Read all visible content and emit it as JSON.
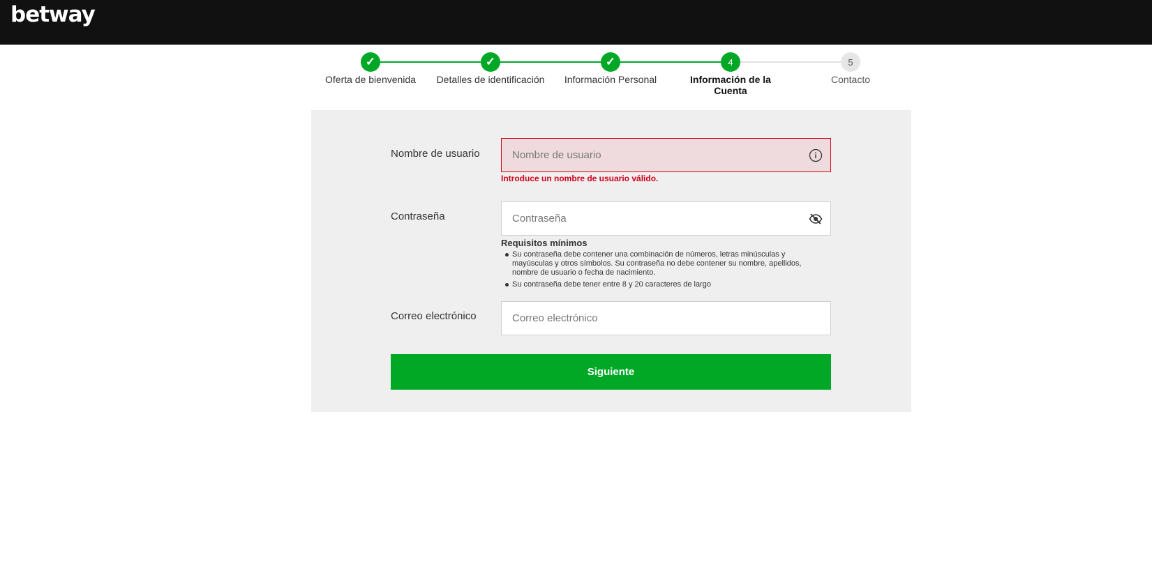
{
  "header": {
    "logo_text": "betway"
  },
  "stepper": {
    "steps": [
      {
        "label": "Oferta de bienvenida",
        "state": "done",
        "marker": "✓"
      },
      {
        "label": "Detalles de identificación",
        "state": "done",
        "marker": "✓"
      },
      {
        "label": "Información Personal",
        "state": "done",
        "marker": "✓"
      },
      {
        "label": "Información de la Cuenta",
        "state": "active",
        "marker": "4"
      },
      {
        "label": "Contacto",
        "state": "todo",
        "marker": "5"
      }
    ]
  },
  "form": {
    "username": {
      "label": "Nombre de usuario",
      "placeholder": "Nombre de usuario",
      "value": "",
      "icon": "info-icon",
      "error": "Introduce un nombre de usuario válido."
    },
    "password": {
      "label": "Contraseña",
      "placeholder": "Contraseña",
      "value": "",
      "icon": "eye-slash-icon",
      "requirements_title": "Requisitos mínimos",
      "requirements": [
        "Su contraseña debe contener una combinación de números, letras minúsculas y mayúsculas y otros símbolos. Su contraseña no debe contener su nombre, apellidos, nombre de usuario o fecha de nacimiento.",
        "Su contraseña debe tener entre 8 y 20 caracteres de largo"
      ]
    },
    "email": {
      "label": "Correo electrónico",
      "placeholder": "Correo electrónico",
      "value": ""
    },
    "next_label": "Siguiente"
  },
  "colors": {
    "brand_green": "#00a826",
    "error_red": "#d0021b",
    "header_bg": "#111111",
    "panel_bg": "#efefef"
  }
}
